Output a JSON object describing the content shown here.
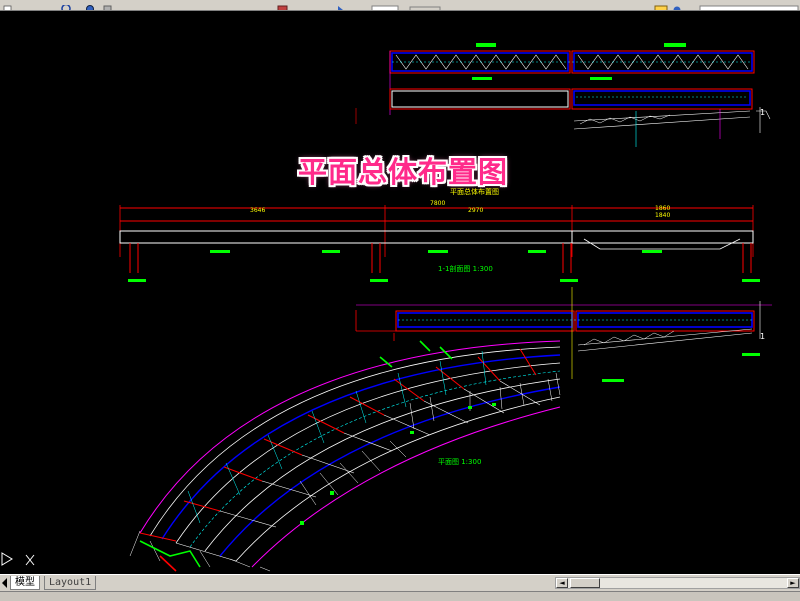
{
  "window": {
    "toolbar_icons": [
      "new-icon",
      "redo-icon",
      "zoom-icon",
      "pan-icon",
      "layer-icon",
      "properties-icon",
      "match-icon",
      "help-icon"
    ]
  },
  "drawing": {
    "banner_title": "平面总体布置图",
    "elevation_title": "平面总体布置图",
    "dim_total": "7800",
    "dim_left": "3646",
    "dim_mid": "2970",
    "dim_right_top": "1860",
    "dim_right_bottom": "1840",
    "section_title": "1-1剖面图 1:300",
    "plan_title": "平面图 1:300",
    "marker_1": "1",
    "marker_2": "1"
  },
  "colors": {
    "background": "#000000",
    "beam_blue": "#0000ff",
    "dim_red": "#ff0000",
    "label_green": "#00ff00",
    "grid_white": "#ffffff",
    "cyan": "#00ffff",
    "magenta": "#ff00ff",
    "banner_pink": "#ff2a8a"
  },
  "tabs": {
    "model": "模型",
    "layout1": "Layout1"
  },
  "scrollbar": {
    "left_arrow": "◄",
    "right_arrow": "►"
  }
}
